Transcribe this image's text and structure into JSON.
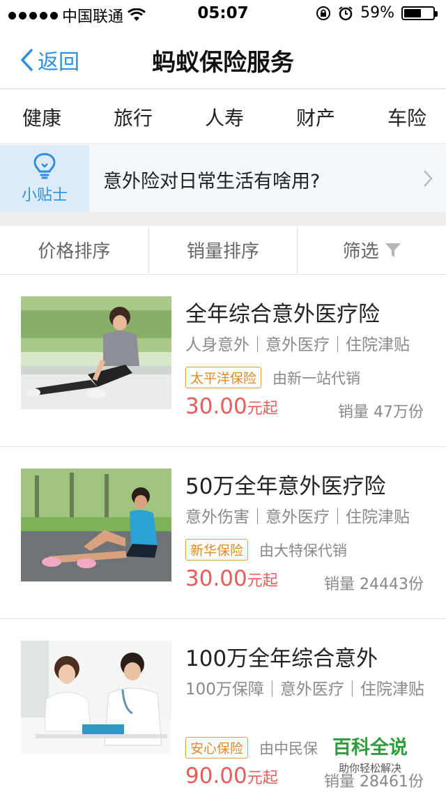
{
  "status_bar": {
    "carrier": "中国联通",
    "time": "05:07",
    "battery": "59%",
    "battery_level": 0.59
  },
  "nav": {
    "back_label": "返回",
    "title": "蚂蚁保险服务"
  },
  "category_tabs": [
    "健康",
    "旅行",
    "人寿",
    "财产",
    "车险"
  ],
  "tip": {
    "badge_label": "小贴士",
    "text": "意外险对日常生活有啥用?"
  },
  "sort_bar": {
    "price": "价格排序",
    "sales": "销量排序",
    "filter": "筛选"
  },
  "products": [
    {
      "title": "全年综合意外医疗险",
      "tags": "人身意外｜意外医疗｜住院津贴",
      "company": "太平洋保险",
      "agent": "由新一站代销",
      "price": "30.00",
      "price_unit": "元起",
      "sales": "销量 47万份"
    },
    {
      "title": "50万全年意外医疗险",
      "tags": "意外伤害｜意外医疗｜住院津贴",
      "company": "新华保险",
      "agent": "由大特保代销",
      "price": "30.00",
      "price_unit": "元起",
      "sales": "销量 24443份"
    },
    {
      "title": "100万全年综合意外",
      "tags": "100万保障｜意外医疗｜住院津贴",
      "company": "安心保险",
      "agent": "由中民保",
      "price": "90.00",
      "price_unit": "元起",
      "sales": "销量 28461份"
    }
  ],
  "watermark": {
    "title": "百科全说",
    "subtitle": "助你轻松解决"
  },
  "colors": {
    "accent": "#2f8ee0",
    "price": "#e85b5b",
    "company": "#e08a24",
    "watermark": "#2e9e3c"
  }
}
